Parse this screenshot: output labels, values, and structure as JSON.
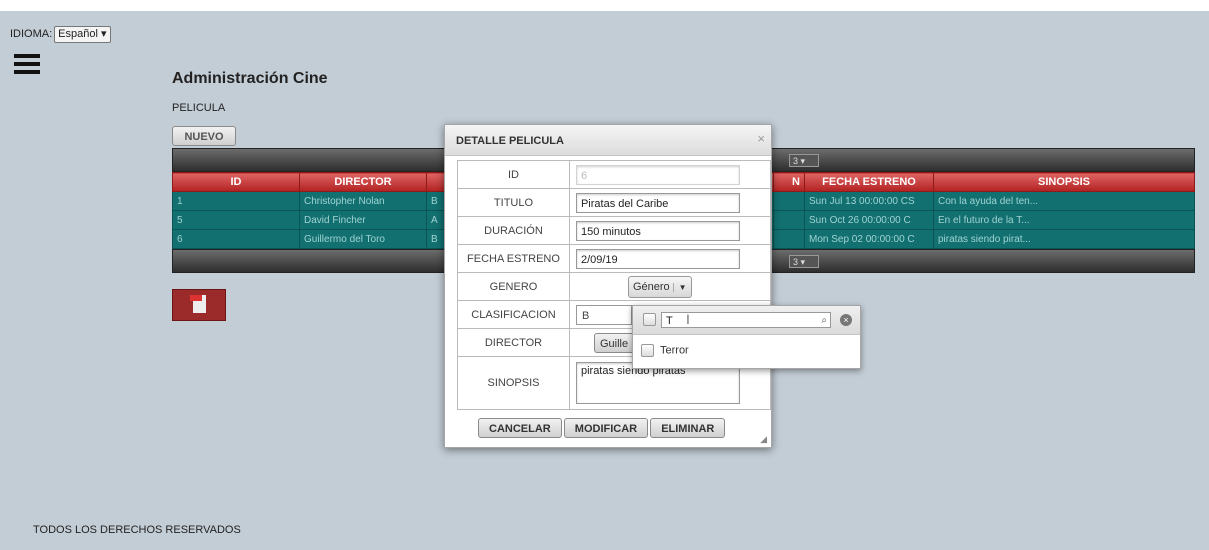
{
  "language": {
    "label": "IDIOMA:",
    "value": "Español"
  },
  "page": {
    "title": "Administración Cine",
    "subtitle": "PELICULA",
    "new_button": "NUEVO"
  },
  "grid": {
    "rows_per_page": "3",
    "columns": [
      "ID",
      "DIRECTOR",
      "",
      "",
      "",
      "N",
      "FECHA ESTRENO",
      "SINOPSIS"
    ],
    "rows": [
      [
        "1",
        "Christopher Nolan",
        "B",
        "",
        "",
        "",
        "Sun Jul 13 00:00:00 CS",
        "Con la ayuda del ten..."
      ],
      [
        "5",
        "David Fincher",
        "A",
        "",
        "",
        "",
        "Sun Oct 26 00:00:00 C",
        "En el futuro de la T..."
      ],
      [
        "6",
        "Guillermo del Toro",
        "B",
        "",
        "",
        "",
        "Mon Sep 02 00:00:00 C",
        "piratas siendo pirat..."
      ]
    ]
  },
  "footer": "TODOS LOS DERECHOS RESERVADOS",
  "dialog": {
    "title": "DETALLE PELICULA",
    "close": "×",
    "fields": {
      "id_label": "ID",
      "id_value": "6",
      "titulo_label": "TITULO",
      "titulo_value": "Piratas del Caribe",
      "duracion_label": "DURACIÓN",
      "duracion_value": "150 minutos",
      "fecha_label": "FECHA ESTRENO",
      "fecha_value": "2/09/19",
      "genero_label": "GENERO",
      "genero_button": "Género",
      "clasificacion_label": "CLASIFICACION",
      "clasificacion_value": "B",
      "director_label": "DIRECTOR",
      "director_value": "Guille",
      "sinopsis_label": "SINOPSIS",
      "sinopsis_value": "piratas siendo piratas"
    },
    "buttons": {
      "cancel": "CANCELAR",
      "modify": "MODIFICAR",
      "delete": "ELIMINAR"
    }
  },
  "genre_popup": {
    "filter_value": "T",
    "options": [
      "Terror"
    ]
  }
}
